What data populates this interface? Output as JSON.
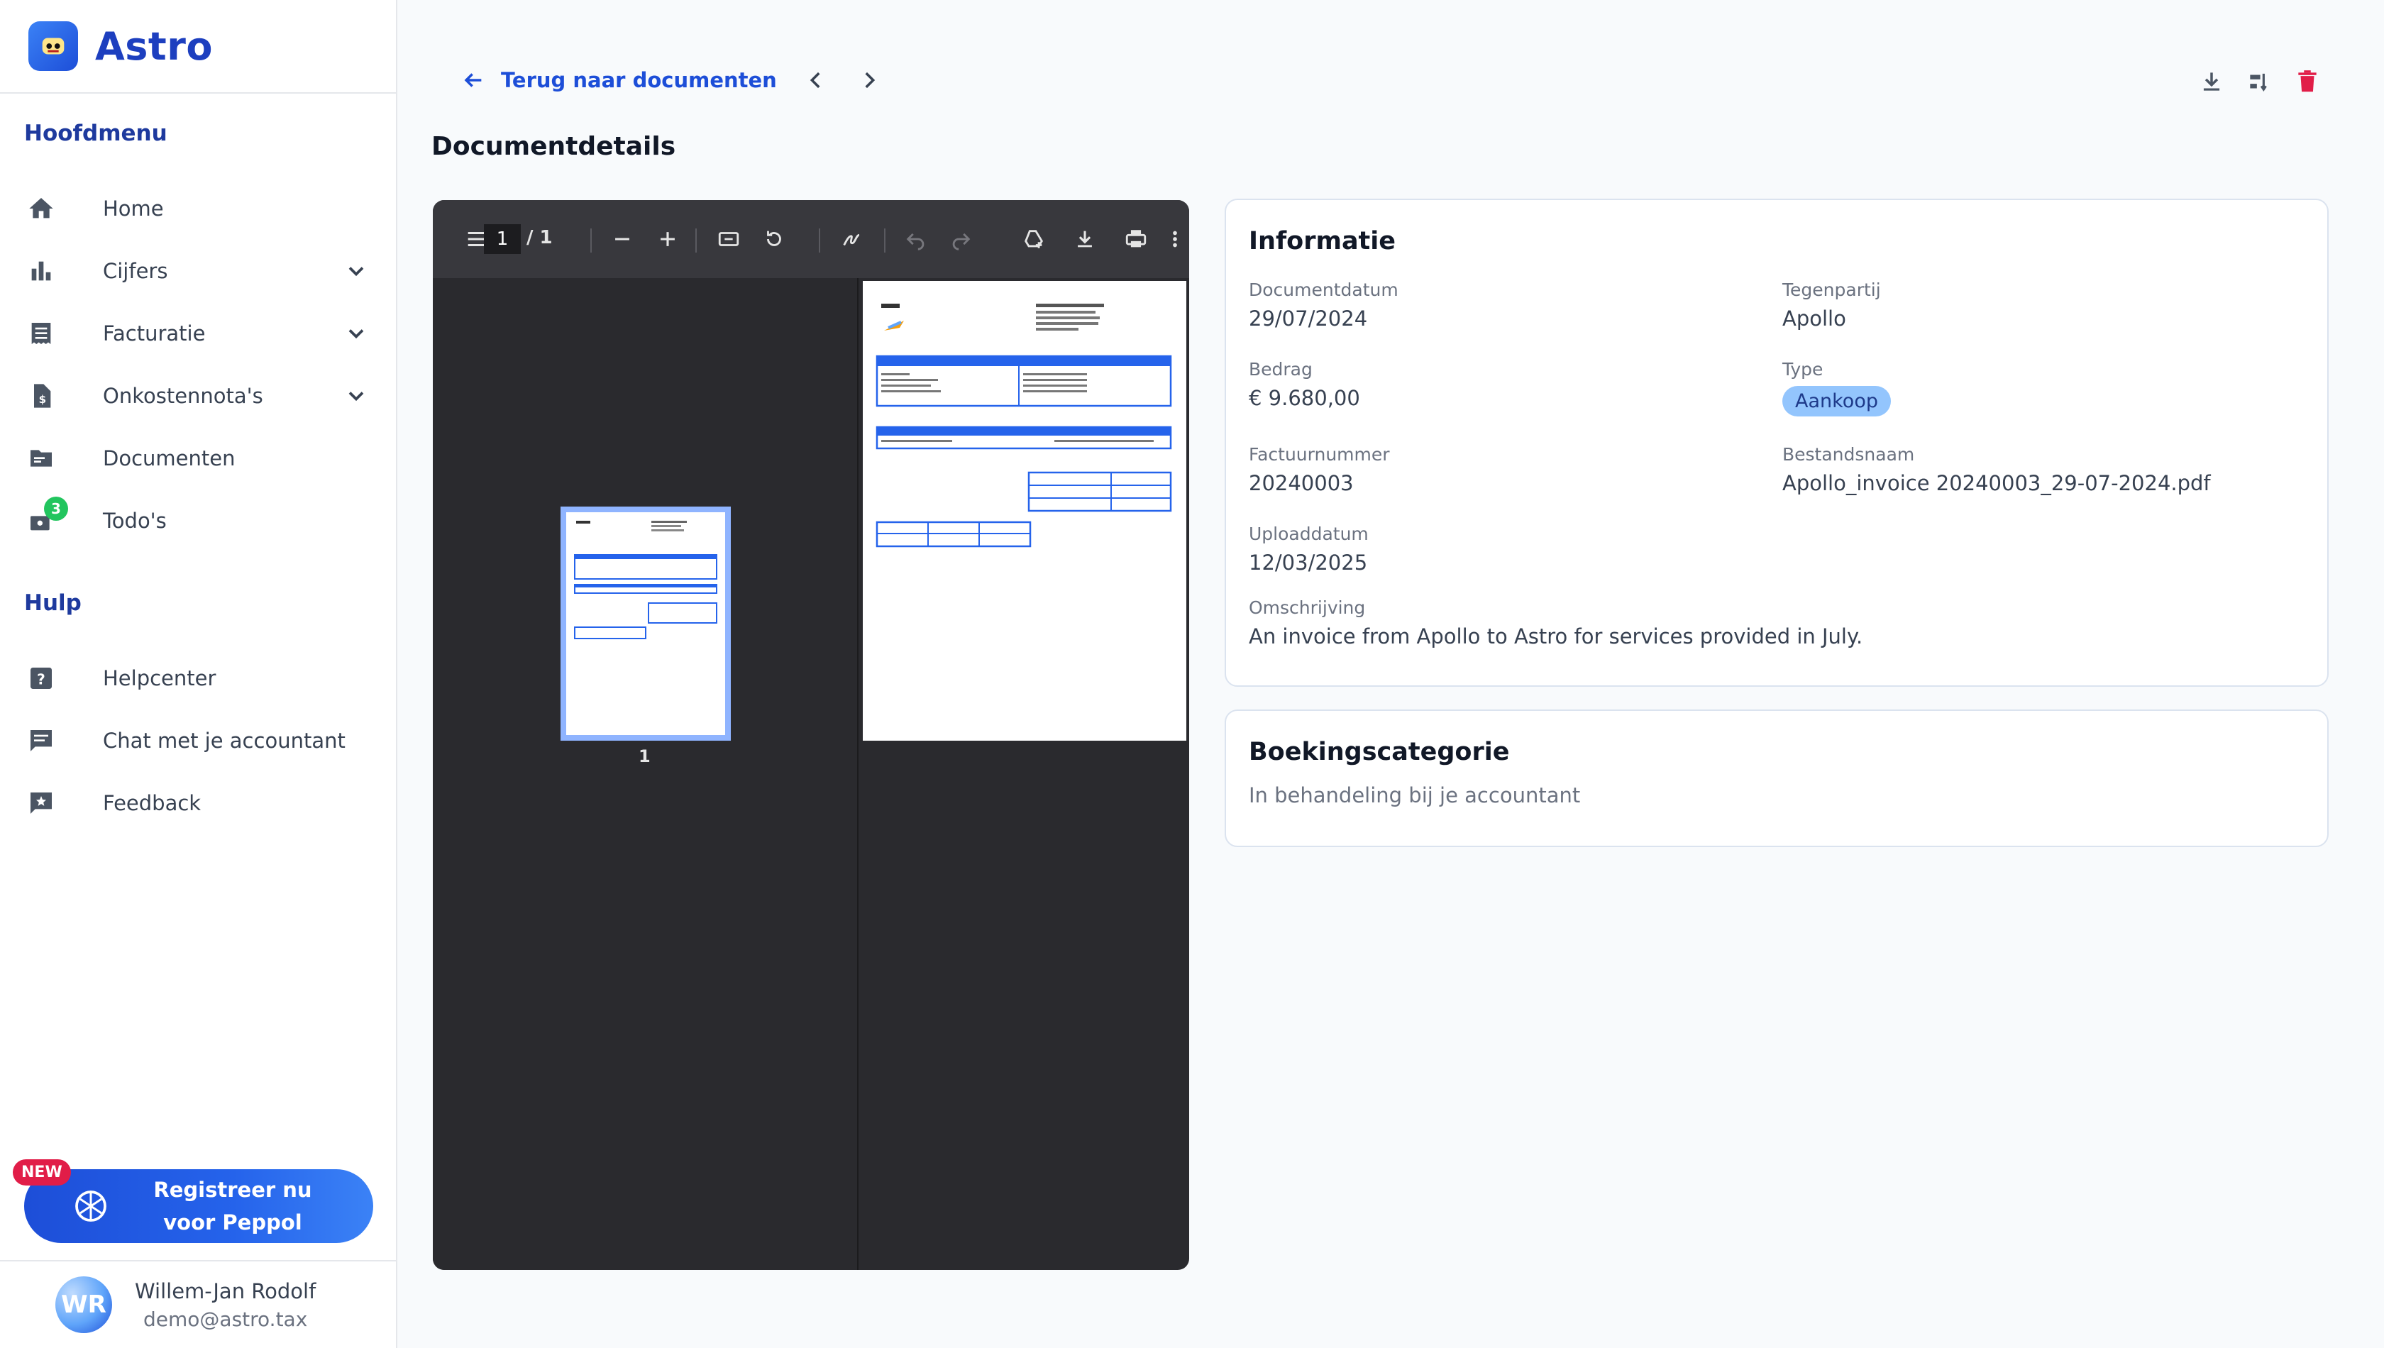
{
  "brand": {
    "name": "Astro"
  },
  "sidebar": {
    "main_title": "Hoofdmenu",
    "items": [
      {
        "label": "Home",
        "icon": "home-icon"
      },
      {
        "label": "Cijfers",
        "icon": "bar-chart-icon"
      },
      {
        "label": "Facturatie",
        "icon": "receipt-icon"
      },
      {
        "label": "Onkostennota's",
        "icon": "expense-file-icon"
      },
      {
        "label": "Documenten",
        "icon": "folder-icon"
      },
      {
        "label": "Todo's",
        "icon": "inbox-icon",
        "badge": "3"
      }
    ],
    "help_title": "Hulp",
    "help_items": [
      {
        "label": "Helpcenter",
        "icon": "help-icon"
      },
      {
        "label": "Chat met je accountant",
        "icon": "chat-icon"
      },
      {
        "label": "Feedback",
        "icon": "feedback-icon"
      }
    ],
    "peppol": {
      "new_tag": "NEW",
      "label": "Registreer nu voor Peppol"
    },
    "user": {
      "initials": "WR",
      "name": "Willem-Jan Rodolf",
      "email": "demo@astro.tax"
    }
  },
  "header": {
    "back_label": "Terug naar documenten",
    "page_title": "Documentdetails"
  },
  "viewer": {
    "current_page": "1",
    "total_pages": "/ 1",
    "thumb_label": "1"
  },
  "info": {
    "title": "Informatie",
    "document_date_label": "Documentdatum",
    "document_date": "29/07/2024",
    "counterparty_label": "Tegenpartij",
    "counterparty": "Apollo",
    "amount_label": "Bedrag",
    "amount": "€ 9.680,00",
    "type_label": "Type",
    "type": "Aankoop",
    "invoice_number_label": "Factuurnummer",
    "invoice_number": "20240003",
    "filename_label": "Bestandsnaam",
    "filename": "Apollo_invoice 20240003_29-07-2024.pdf",
    "upload_date_label": "Uploaddatum",
    "upload_date": "12/03/2025",
    "description_label": "Omschrijving",
    "description": "An invoice from Apollo to Astro for services provided in July."
  },
  "booking": {
    "title": "Boekingscategorie",
    "status": "In behandeling bij je accountant"
  },
  "colors": {
    "accent": "#1d4ed8",
    "delete": "#e11d48",
    "badge": "#22c55e"
  }
}
